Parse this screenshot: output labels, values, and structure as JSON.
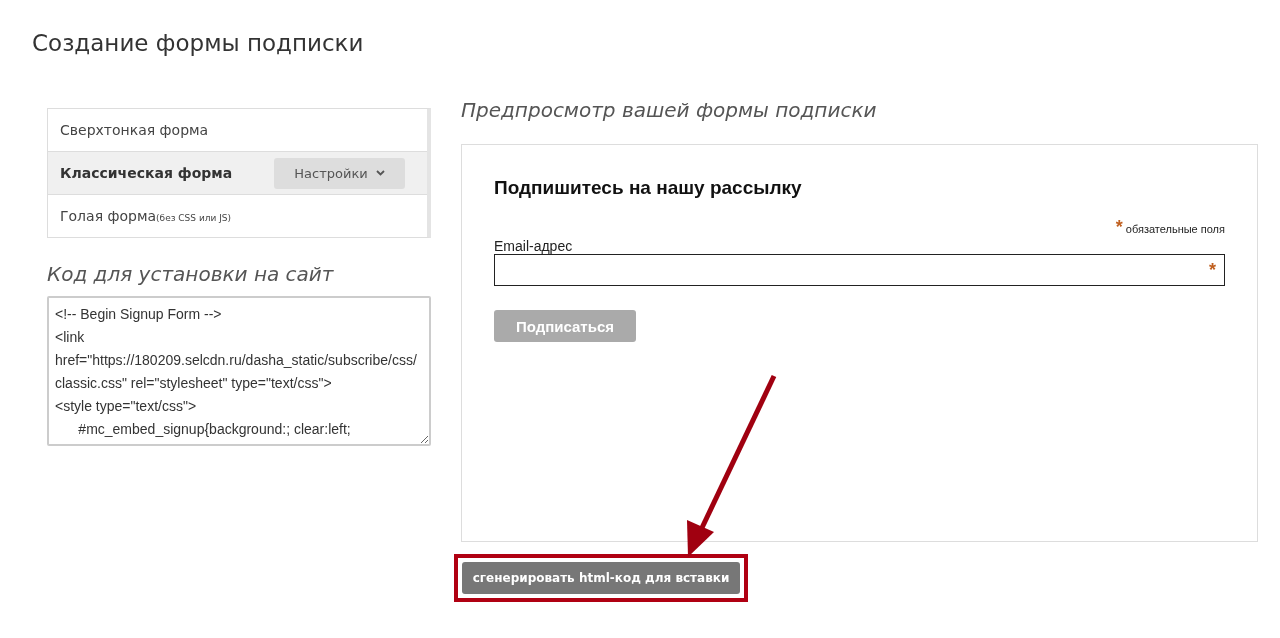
{
  "page_title": "Создание формы подписки",
  "form_types": [
    {
      "label": "Сверхтонкая форма",
      "selected": false
    },
    {
      "label": "Классическая форма",
      "selected": true,
      "action": "Настройки"
    },
    {
      "label": "Голая форма",
      "note": "(без CSS или JS)",
      "selected": false
    }
  ],
  "code_section": {
    "title": "Код для установки на сайт",
    "code": "<!-- Begin Signup Form -->\n<link href=\"https://180209.selcdn.ru/dasha_static/subscribe/css/classic.css\" rel=\"stylesheet\" type=\"text/css\">\n<style type=\"text/css\">\n      #mc_embed_signup{background:; clear:left;"
  },
  "preview": {
    "title": "Предпросмотр вашей формы подписки",
    "form_title": "Подпишитесь на нашу рассылку",
    "required_mark": "*",
    "required_note": "обязательные поля",
    "email_label": "Email-адрес",
    "field_mark": "*",
    "submit": "Подписаться"
  },
  "generate_button": "сгенерировать html-код для вставки"
}
